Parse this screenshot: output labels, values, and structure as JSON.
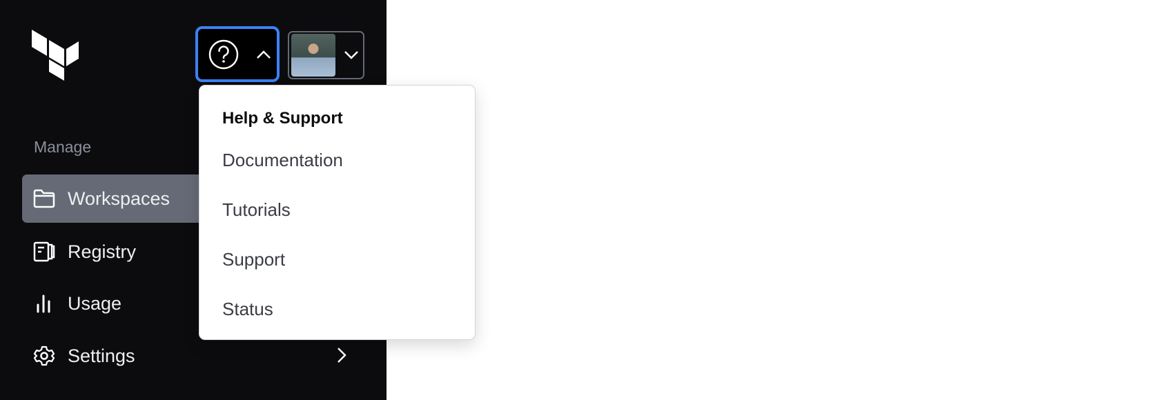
{
  "sidebar": {
    "section_label": "Manage",
    "items": [
      {
        "label": "Workspaces",
        "icon": "folder-icon",
        "active": true
      },
      {
        "label": "Registry",
        "icon": "registry-icon"
      },
      {
        "label": "Usage",
        "icon": "bar-chart-icon"
      },
      {
        "label": "Settings",
        "icon": "gear-icon",
        "has_submenu": true
      }
    ]
  },
  "header": {
    "help_icon": "help-circle-icon",
    "help_expanded": true,
    "user_menu_icon": "chevron-down-icon"
  },
  "help_menu": {
    "title": "Help & Support",
    "items": [
      "Documentation",
      "Tutorials",
      "Support",
      "Status"
    ]
  },
  "colors": {
    "sidebar_bg": "#0c0c0e",
    "active_item": "#656a76",
    "focus_ring": "#3b82f6"
  }
}
